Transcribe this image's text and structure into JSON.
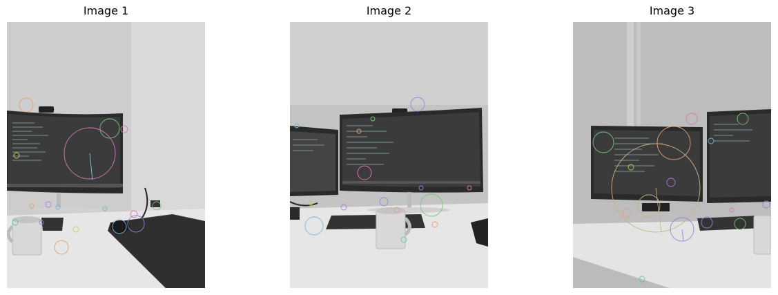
{
  "figure": {
    "panels": [
      {
        "title": "Image 1",
        "scene": "desk-with-curved-monitor-mug-and-mousepad",
        "keypoint_overlay": true
      },
      {
        "title": "Image 2",
        "scene": "desk-with-curved-monitor-second-monitor-left-and-mug",
        "keypoint_overlay": true
      },
      {
        "title": "Image 3",
        "scene": "desk-with-two-monitors-and-mug-angled-view",
        "keypoint_overlay": true
      }
    ],
    "colors": {
      "wall": "#c9c9c9",
      "desk": "#e4e4e4",
      "monitor": "#2a2a2a",
      "screen": "#3b3b3b",
      "mousepad": "#2f2f2f",
      "mug": "#d8d8d8",
      "keypoints": [
        "#e4a07a",
        "#7ac47a",
        "#8a8ad8",
        "#d87ab4",
        "#7ab8d8",
        "#c8c85a",
        "#b07ad8",
        "#5ac8a0"
      ]
    }
  }
}
